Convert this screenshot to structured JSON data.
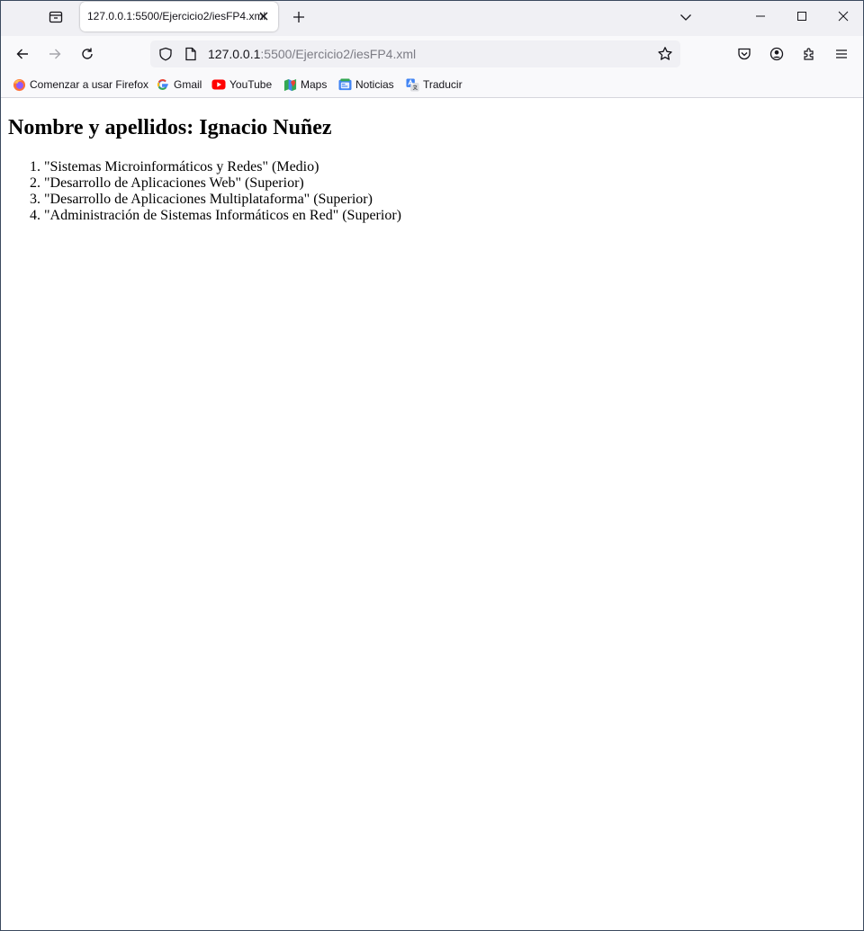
{
  "browser": {
    "tab": {
      "title": "127.0.0.1:5500/Ejercicio2/iesFP4.xml"
    },
    "url": {
      "host": "127.0.0.1",
      "rest": ":5500/Ejercicio2/iesFP4.xml"
    },
    "bookmarks": [
      {
        "label": "Comenzar a usar Firefox",
        "icon": "firefox-icon"
      },
      {
        "label": "Gmail",
        "icon": "google-icon"
      },
      {
        "label": "YouTube",
        "icon": "youtube-icon"
      },
      {
        "label": "Maps",
        "icon": "maps-icon"
      },
      {
        "label": "Noticias",
        "icon": "news-icon"
      },
      {
        "label": "Traducir",
        "icon": "translate-icon"
      }
    ],
    "colors": {
      "tabstrip": "#f0f0f4",
      "toolbar": "#f9f9fb",
      "urlbar": "#f0f0f4"
    }
  },
  "page": {
    "heading": "Nombre y apellidos: Ignacio Nuñez",
    "items": [
      "\"Sistemas Microinformáticos y Redes\" (Medio)",
      "\"Desarrollo de Aplicaciones Web\" (Superior)",
      "\"Desarrollo de Aplicaciones Multiplataforma\" (Superior)",
      "\"Administración de Sistemas Informáticos en Red\" (Superior)"
    ]
  }
}
